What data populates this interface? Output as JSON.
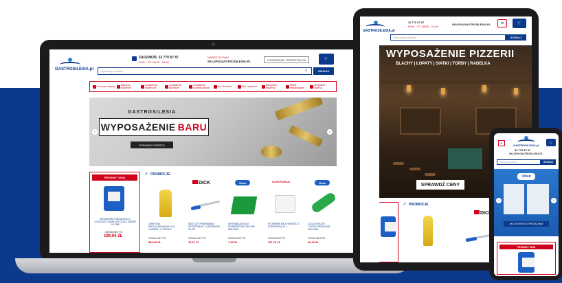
{
  "colors": {
    "brand_blue": "#0b3a8c",
    "accent_red": "#d0021b",
    "background_band": "#0b3a8c"
  },
  "site": {
    "logo_text": "GASTROSILESIA.pl",
    "phone_label": "ZADZWOŃ: 32 770 87 87",
    "hours": "PON. - PT. 08:00 - 16:00",
    "write_label": "NAPISZ DO NAS",
    "email": "SKLEP@GASTROSILESIA.PL",
    "login_label": "LOGOWANIE / REJESTRACJA",
    "search_placeholder": "Wyszukaj produkty",
    "search_button": "SZUKAJ"
  },
  "categories": [
    "Przemysł mięsny",
    "Maszyny kuchenne",
    "Urządzenia chłodnicze",
    "Urządzenia grzewcze",
    "Urządzenia przeładunkowe",
    "Bar i kuchnia",
    "Stal i wyposaż.",
    "Naczynia i przybory",
    "Meble restauracyjne",
    "Zmywanie i higiena"
  ],
  "bar_banner": {
    "brand": "GASTROSILESIA",
    "title_main": "WYPOSAŻENIE",
    "title_accent": "BARU",
    "cta": "SPRAWDŹ OFERTĘ"
  },
  "product_of_day": {
    "header": "PRODUKT DNIA",
    "name": "BEVIAN BIOT MEDIUM 10 L OSUSZACZ NABŁYSZCZACZ SMART ULTRA",
    "price_label": "CENA NETTO",
    "price": "199,04 ZŁ"
  },
  "promotions": {
    "title": "PROMOCJE",
    "items": [
      {
        "brand": "",
        "name": "CHWYTAK WIELOZADANIOWY DO LIMONKI I CYTRYNY",
        "price_label": "CENA NETTO",
        "price": "386,08 ZŁ"
      },
      {
        "brand": "DICK",
        "name": "NÓŻ DO TRYBOWANIA SPORTSMAN 1 CZERWONY 18 CM",
        "price_label": "CENA NETTO",
        "price": "39,67 ZŁ"
      },
      {
        "brand": "Vikan",
        "name": "SKROBACZKA DO POWIERZCHNI 260 MM ZIELONA",
        "price_label": "CENA NETTO",
        "price": "7,36 ZŁ"
      },
      {
        "brand": "GASTRORAG",
        "name": "POJEMNIK NA ŻYWNOŚĆ Z POKRYWKĄ 10 L",
        "price_label": "CENA NETTO",
        "price": "261,78 ZŁ"
      },
      {
        "brand": "Vikan",
        "name": "SZCZOTKA DO CZYSZCZENIA RUR ZIELONA",
        "price_label": "CENA NETTO",
        "price": "86,49 ZŁ"
      }
    ]
  },
  "tablet": {
    "phone": "32 770 87 87",
    "email": "SKLEP@GASTROSILESIA.PL",
    "search_button": "SZUKAJ",
    "hero_title": "WYPOSAŻENIE PIZZERII",
    "hero_sub": "BLACHY | ŁOPATY | SIATKI | TORBY | RADEŁKA",
    "hero_cta": "SPRAWDŹ CENY",
    "promotions_title": "PROMOCJE",
    "brand": "DICK"
  },
  "phone_view": {
    "phone": "32 770 87 87",
    "email": "SKLEP@GASTROSILESIA.PL",
    "search_button": "SZUKAJ",
    "banner_brand": "Vikan",
    "banner_cta": "AKCESORIA DO SPRZĄTANIA",
    "product_of_day": "PRODUKT DNIA"
  }
}
